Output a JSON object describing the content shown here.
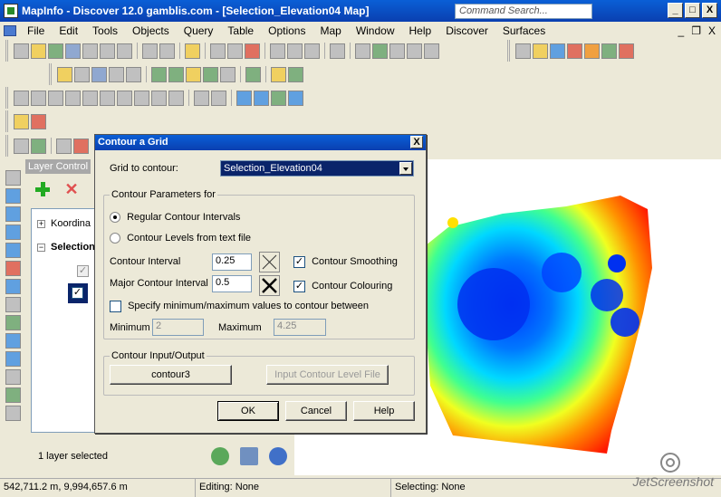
{
  "window": {
    "title": "MapInfo - Discover 12.0   gamblis.com - [Selection_Elevation04 Map]",
    "search_placeholder": "Command Search...",
    "btn_min": "_",
    "btn_max": "□",
    "btn_close": "X"
  },
  "menu": [
    "File",
    "Edit",
    "Tools",
    "Objects",
    "Query",
    "Table",
    "Options",
    "Map",
    "Window",
    "Help",
    "Discover",
    "Surfaces"
  ],
  "mdi": {
    "min": "_",
    "restore": "❐",
    "close": "X"
  },
  "layer_control": {
    "title": "Layer Control",
    "add_icon": "plus-icon",
    "remove_icon": "x-icon",
    "items": [
      {
        "label": "Koordina",
        "expander": "+",
        "bold": false
      },
      {
        "label": "Selection",
        "expander": "−",
        "bold": true
      }
    ],
    "status": "1 layer selected"
  },
  "dialog": {
    "title": "Contour a Grid",
    "close": "X",
    "grid_label": "Grid to contour:",
    "grid_value": "Selection_Elevation04",
    "params_group": "Contour Parameters for",
    "radio_regular": "Regular Contour Intervals",
    "radio_file": "Contour Levels from text file",
    "interval_label": "Contour Interval",
    "interval_value": "0.25",
    "major_label": "Major Contour Interval",
    "major_value": "0.5",
    "smoothing_label": "Contour Smoothing",
    "colouring_label": "Contour Colouring",
    "specify_label": "Specify minimum/maximum values to contour between",
    "minimum_label": "Minimum",
    "minimum_value": "2",
    "maximum_label": "Maximum",
    "maximum_value": "4.25",
    "io_group": "Contour Input/Output",
    "contour_btn": "contour3",
    "input_file_btn": "Input Contour Level File",
    "ok": "OK",
    "cancel": "Cancel",
    "help": "Help"
  },
  "status": {
    "coords": "542,711.2 m, 9,994,657.6 m",
    "editing": "Editing: None",
    "selecting": "Selecting: None"
  },
  "watermark": "JetScreenshot"
}
